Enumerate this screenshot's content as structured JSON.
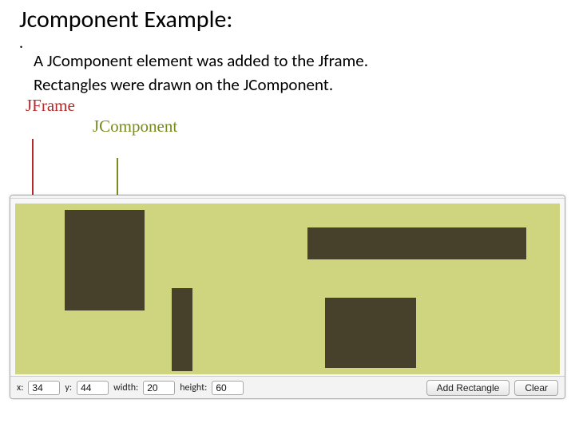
{
  "title": "Jcomponent Example:",
  "bullet": ".",
  "description_line1": "A JComponent element was added to the Jframe.",
  "description_line2": "Rectangles were drawn on the JComponent.",
  "labels": {
    "jframe": "JFrame",
    "jcomponent": "JComponent"
  },
  "toolbar": {
    "x_label": "x:",
    "x_value": "34",
    "y_label": "y:",
    "y_value": "44",
    "width_label": "width:",
    "width_value": "20",
    "height_label": "height:",
    "height_value": "60",
    "add_label": "Add Rectangle",
    "clear_label": "Clear"
  }
}
